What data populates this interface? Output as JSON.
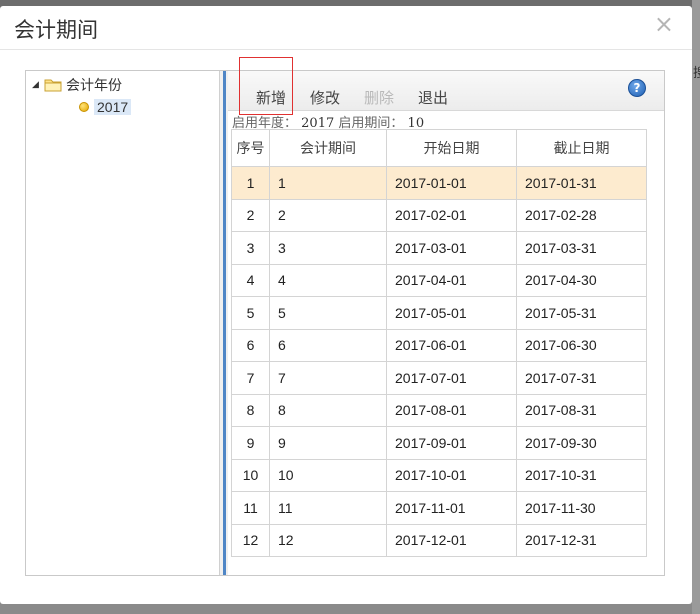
{
  "backdrop": {
    "edge_char": "搜"
  },
  "dialog": {
    "title": "会计期间",
    "close_label": "×"
  },
  "tree": {
    "root": {
      "label": "会计年份",
      "expanded": true
    },
    "children": [
      {
        "label": "2017",
        "selected": true
      }
    ]
  },
  "toolbar": {
    "add_label": "新增",
    "edit_label": "修改",
    "delete_label": "删除",
    "exit_label": "退出",
    "help_label": "?"
  },
  "info": {
    "year_label": "启用年度：",
    "year_value": "2017",
    "period_label": "启用期间：",
    "period_value": "10"
  },
  "table": {
    "columns": [
      "序号",
      "会计期间",
      "开始日期",
      "截止日期"
    ],
    "rows": [
      {
        "seq": "1",
        "period": "1",
        "start": "2017-01-01",
        "end": "2017-01-31"
      },
      {
        "seq": "2",
        "period": "2",
        "start": "2017-02-01",
        "end": "2017-02-28"
      },
      {
        "seq": "3",
        "period": "3",
        "start": "2017-03-01",
        "end": "2017-03-31"
      },
      {
        "seq": "4",
        "period": "4",
        "start": "2017-04-01",
        "end": "2017-04-30"
      },
      {
        "seq": "5",
        "period": "5",
        "start": "2017-05-01",
        "end": "2017-05-31"
      },
      {
        "seq": "6",
        "period": "6",
        "start": "2017-06-01",
        "end": "2017-06-30"
      },
      {
        "seq": "7",
        "period": "7",
        "start": "2017-07-01",
        "end": "2017-07-31"
      },
      {
        "seq": "8",
        "period": "8",
        "start": "2017-08-01",
        "end": "2017-08-31"
      },
      {
        "seq": "9",
        "period": "9",
        "start": "2017-09-01",
        "end": "2017-09-30"
      },
      {
        "seq": "10",
        "period": "10",
        "start": "2017-10-01",
        "end": "2017-10-31"
      },
      {
        "seq": "11",
        "period": "11",
        "start": "2017-11-01",
        "end": "2017-11-30"
      },
      {
        "seq": "12",
        "period": "12",
        "start": "2017-12-01",
        "end": "2017-12-31"
      }
    ],
    "selected_row": 0
  },
  "colors": {
    "selected_row_bg": "#fdebcf",
    "splitter": "#4f86c6",
    "highlight_box": "#e03131"
  },
  "icons": {
    "close": "close-icon",
    "tree_toggle": "triangle-expanded-icon",
    "folder": "folder-icon",
    "year_node": "dot-icon",
    "help": "help-icon"
  }
}
